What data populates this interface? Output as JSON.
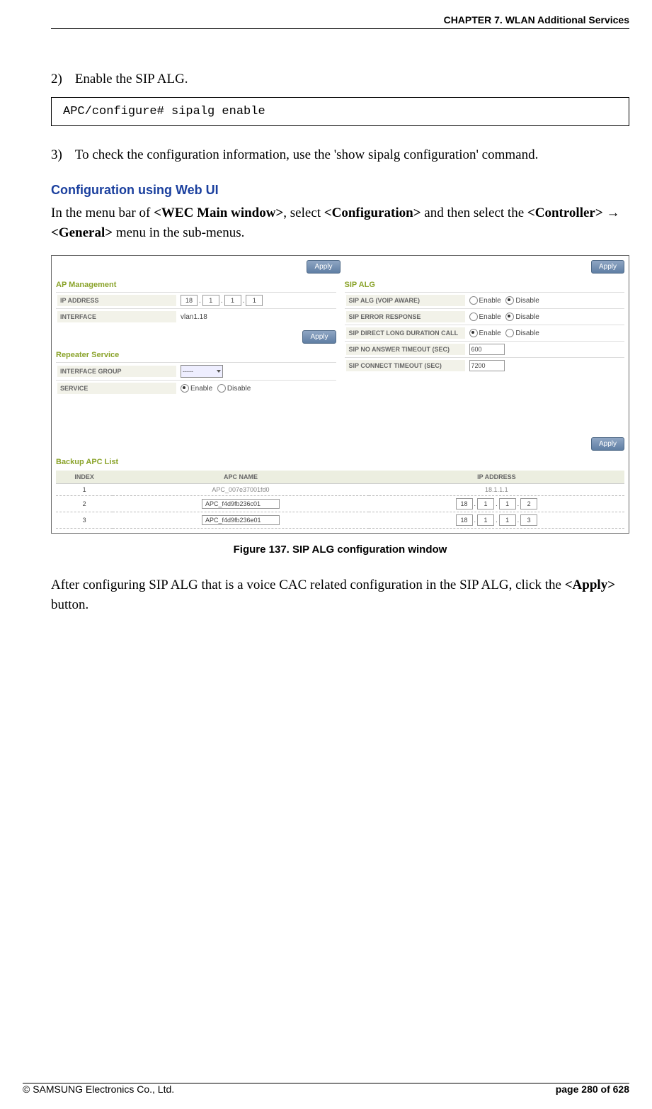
{
  "header": {
    "chapter": "CHAPTER 7. WLAN Additional Services"
  },
  "footer": {
    "copyright": "© SAMSUNG Electronics Co., Ltd.",
    "page": "page 280 of 628"
  },
  "step2": {
    "num": "2)",
    "text": "Enable the SIP ALG."
  },
  "code": {
    "line": "APC/configure# sipalg enable"
  },
  "step3": {
    "num": "3)",
    "text": "To check the configuration information, use the 'show sipalg configuration' command."
  },
  "section_heading": "Configuration using Web UI",
  "para_nav": {
    "pre": "In the menu bar of ",
    "b1": "<WEC Main window>",
    "mid1": ", select ",
    "b2": "<Configuration>",
    "mid2": " and then select the ",
    "b3": "<Controller>",
    "arrow": " → ",
    "b4": "<General>",
    "post": " menu in the sub-menus."
  },
  "figure": {
    "apply_label": "Apply",
    "ap_mgmt_title": "AP Management",
    "sip_alg_title": "SIP ALG",
    "repeater_title": "Repeater Service",
    "backup_title": "Backup APC List",
    "labels": {
      "ip_address": "IP ADDRESS",
      "interface": "INTERFACE",
      "interface_group": "INTERFACE GROUP",
      "service": "SERVICE",
      "sip_voip": "SIP ALG (VOIP AWARE)",
      "sip_err": "SIP ERROR RESPONSE",
      "sip_long": "SIP DIRECT LONG DURATION CALL",
      "sip_noans": "SIP NO ANSWER TIMEOUT (SEC)",
      "sip_conn": "SIP CONNECT TIMEOUT (SEC)"
    },
    "values": {
      "ip1": "18",
      "ip2": "1",
      "ip3": "1",
      "ip4": "1",
      "iface": "vlan1.18",
      "igroup": "-----",
      "noans": "600",
      "conn": "7200"
    },
    "opt": {
      "enable": "Enable",
      "disable": "Disable"
    },
    "table": {
      "h1": "INDEX",
      "h2": "APC NAME",
      "h3": "IP ADDRESS",
      "rows": [
        {
          "idx": "1",
          "name": "APC_007e37001fd0",
          "ip": "18.1.1.1",
          "editable": false
        },
        {
          "idx": "2",
          "name": "APC_f4d9fb236c01",
          "ip": [
            "18",
            "1",
            "1",
            "2"
          ],
          "editable": true
        },
        {
          "idx": "3",
          "name": "APC_f4d9fb236e01",
          "ip": [
            "18",
            "1",
            "1",
            "3"
          ],
          "editable": true
        }
      ]
    }
  },
  "fig_caption": "Figure 137. SIP ALG configuration window",
  "para_after": {
    "pre": "After configuring SIP ALG that is a voice CAC related configuration in the SIP ALG, click the ",
    "b1": "<Apply>",
    "post": " button."
  }
}
